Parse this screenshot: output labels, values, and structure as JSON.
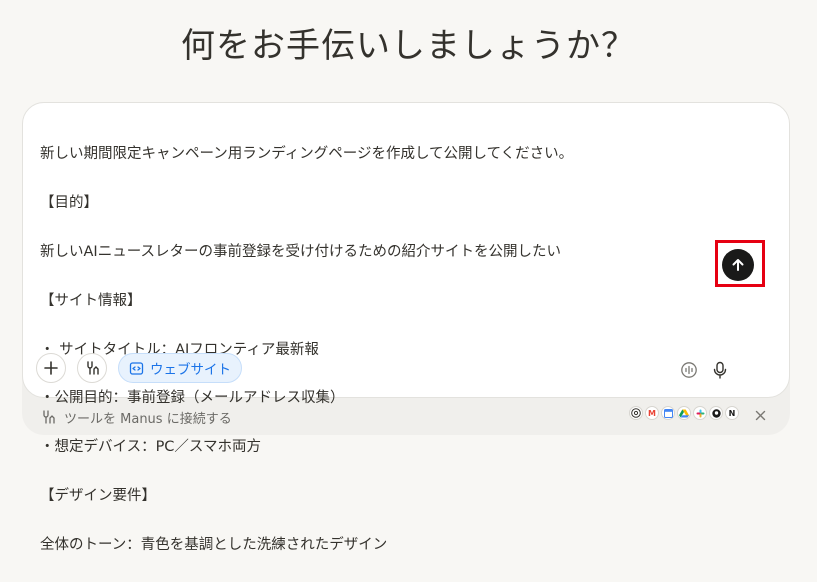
{
  "heading": "何をお手伝いしましょうか？",
  "prompt": {
    "lines": [
      "新しい期間限定キャンペーン用ランディングページを作成して公開してください。",
      "【目的】",
      "新しいAIニュースレターの事前登録を受け付けるための紹介サイトを公開したい",
      "【サイト情報】",
      "・ サイトタイトル：AIフロンティア最新報",
      "・公開目的：事前登録（メールアドレス収集）",
      "・想定デバイス：PC／スマホ両方",
      "【デザイン要件】",
      "全体のトーン：青色を基調とした洗練されたデザイン"
    ]
  },
  "toolbar": {
    "plus_icon": "plus-icon",
    "tools_icon": "tools-icon",
    "website_chip": {
      "icon": "code-window-icon",
      "label": "ウェブサイト"
    },
    "voice_icon": "voice-mode-icon",
    "mic_icon": "microphone-icon",
    "send_icon": "arrow-up-icon"
  },
  "connect_bar": {
    "icon": "plug-icon",
    "label": "ツールを Manus に接続する",
    "apps": [
      "chrome",
      "gmail",
      "google-calendar",
      "google-drive",
      "slack",
      "github",
      "notion"
    ],
    "close_icon": "close-icon"
  },
  "colors": {
    "accent_blue": "#1a73e8",
    "highlight_red": "#e60012",
    "send_black": "#1a1a19"
  }
}
